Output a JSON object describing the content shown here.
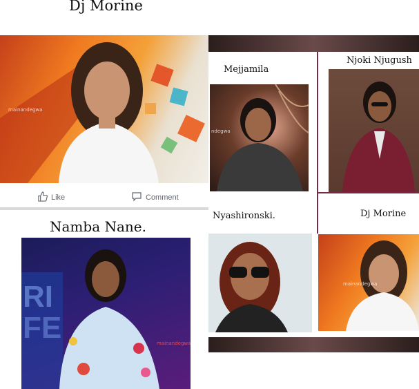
{
  "captions": {
    "top_left_title": "Dj Morine",
    "mejjamila": "Mejjamila",
    "njoki": "Njoki Njugush",
    "namba_nane": "Namba Nane.",
    "nyashironski": "Nyashironski.",
    "dj_morine_small": "Dj Morine"
  },
  "facebook_actions": {
    "like_label": "Like",
    "comment_label": "Comment"
  },
  "watermarks": {
    "main": "mainandegwa",
    "mejjamila": "ndegwa",
    "namba": "mainandegwa",
    "dj_small": "mainandegwa"
  },
  "icons": [
    "thumbs-up-icon",
    "comment-bubble-icon"
  ],
  "colors": {
    "divider_maroon": "#7a2945",
    "fb_grey": "#606770",
    "dark_banner": "#2a1e1c"
  }
}
